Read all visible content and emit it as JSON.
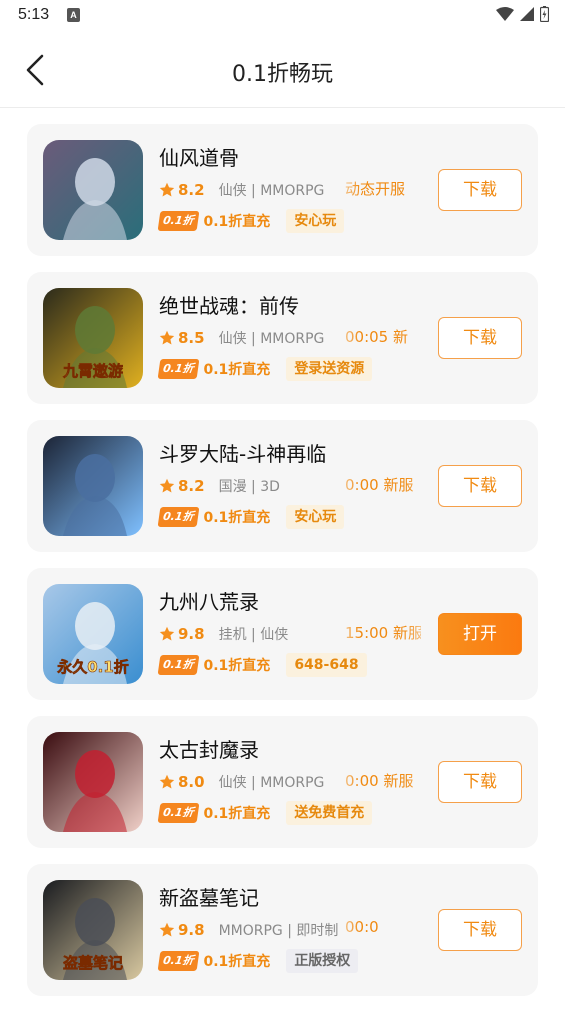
{
  "status": {
    "time": "5:13",
    "notif": "A"
  },
  "header": {
    "title": "0.1折畅玩"
  },
  "games": [
    {
      "name": "仙风道骨",
      "score": "8.2",
      "tags": "仙侠 | MMORPG",
      "extra": "动态开服",
      "zhe_badge": "0.1折",
      "zhe_text": "0.1折直充",
      "badge": "安心玩",
      "badge_style": "orange",
      "button": "下载",
      "button_style": "outline",
      "icon_colors": [
        "#6b5b7a",
        "#cfd8e6",
        "#2a6e7a"
      ]
    },
    {
      "name": "绝世战魂：前传",
      "score": "8.5",
      "tags": "仙侠 | MMORPG",
      "extra": "00:05 新",
      "zhe_badge": "0.1折",
      "zhe_text": "0.1折直充",
      "badge": "登录送资源",
      "badge_style": "orange",
      "button": "下载",
      "button_style": "outline",
      "icon_colors": [
        "#2b2a1c",
        "#5e7a36",
        "#e0b020"
      ],
      "icon_text": "九霄遨游"
    },
    {
      "name": "斗罗大陆-斗神再临",
      "score": "8.2",
      "tags": "国漫 | 3D",
      "extra": "0:00 新服",
      "extra_tail": "1",
      "zhe_badge": "0.1折",
      "zhe_text": "0.1折直充",
      "badge": "安心玩",
      "badge_style": "orange",
      "button": "下载",
      "button_style": "outline",
      "icon_colors": [
        "#1c2436",
        "#4a6fa0",
        "#7fc0ff"
      ]
    },
    {
      "name": "九州八荒录",
      "score": "9.8",
      "tags": "挂机 | 仙侠",
      "extra": "15:00 新服",
      "zhe_badge": "0.1折",
      "zhe_text": "0.1折直充",
      "badge": "648-648",
      "badge_style": "orange",
      "button": "打开",
      "button_style": "filled",
      "icon_colors": [
        "#a8c8e8",
        "#e8eef5",
        "#3a8ed0"
      ],
      "icon_text": "永久0.1折"
    },
    {
      "name": "太古封魔录",
      "score": "8.0",
      "tags": "仙侠 | MMORPG",
      "extra": "0:00 新服",
      "zhe_badge": "0.1折",
      "zhe_text": "0.1折直充",
      "badge": "送免费首充",
      "badge_style": "orange",
      "button": "下载",
      "button_style": "outline",
      "icon_colors": [
        "#3a0c10",
        "#c22030",
        "#f0d0c8"
      ]
    },
    {
      "name": "新盗墓笔记",
      "score": "9.8",
      "tags": "MMORPG | 即时制",
      "extra": "00:0",
      "zhe_badge": "0.1折",
      "zhe_text": "0.1折直充",
      "badge": "正版授权",
      "badge_style": "gray",
      "button": "下载",
      "button_style": "outline",
      "icon_colors": [
        "#1a1c20",
        "#4a4e56",
        "#d8c8a0"
      ],
      "icon_text": "盗墓笔记"
    }
  ]
}
